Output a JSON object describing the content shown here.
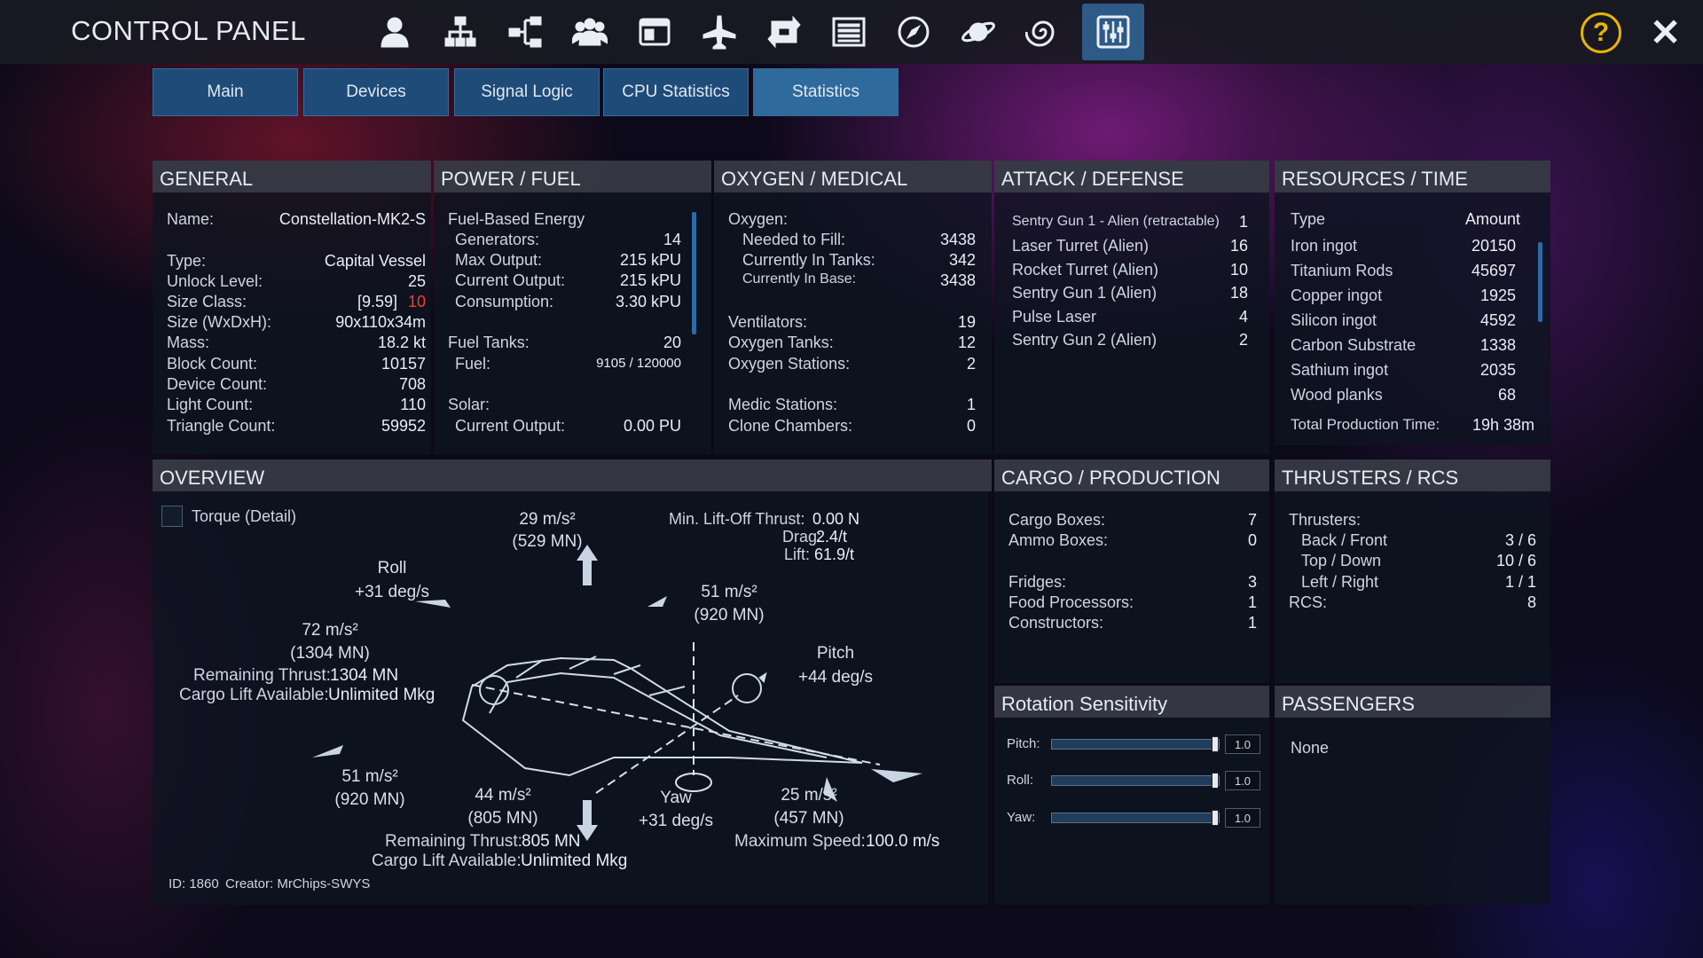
{
  "header": {
    "title": "CONTROL PANEL",
    "help_label": "?",
    "close_label": "✕"
  },
  "nav_icons": [
    "player-icon",
    "network-icon",
    "structure-icon",
    "group-icon",
    "window-icon",
    "aircraft-icon",
    "transfer-icon",
    "list-icon",
    "compass-icon",
    "planet-icon",
    "spiral-icon",
    "control-panel-icon"
  ],
  "tabs": [
    {
      "label": "Main"
    },
    {
      "label": "Devices"
    },
    {
      "label": "Signal Logic"
    },
    {
      "label": "CPU Statistics"
    },
    {
      "label": "Statistics"
    }
  ],
  "general": {
    "title": "GENERAL",
    "name_label": "Name:",
    "name": "Constellation-MK2-S",
    "type_label": "Type:",
    "type": "Capital Vessel",
    "unlock_label": "Unlock Level:",
    "unlock": "25",
    "sizeclass_label": "Size Class:",
    "sizeclass": "[9.59]",
    "sizeclass_max": "10",
    "size_label": "Size (WxDxH):",
    "size": "90x110x34m",
    "mass_label": "Mass:",
    "mass": "18.2 kt",
    "block_label": "Block Count:",
    "block": "10157",
    "device_label": "Device Count:",
    "device": "708",
    "light_label": "Light Count:",
    "light": "110",
    "tri_label": "Triangle Count:",
    "tri": "59952"
  },
  "power": {
    "title": "POWER / FUEL",
    "feb_label": "Fuel-Based Energy",
    "gen_label": "Generators:",
    "gen": "14",
    "maxout_label": "Max Output:",
    "maxout": "215 kPU",
    "curout_label": "Current Output:",
    "curout": "215 kPU",
    "cons_label": "Consumption:",
    "cons": "3.30 kPU",
    "tanks_label": "Fuel Tanks:",
    "tanks": "20",
    "fuel_label": "Fuel:",
    "fuel": "9105 / 120000",
    "solar_label": "Solar:",
    "solarout_label": "Current Output:",
    "solarout": "0.00 PU"
  },
  "oxygen": {
    "title": "OXYGEN / MEDICAL",
    "oxy_label": "Oxygen:",
    "fill_label": "Needed to Fill:",
    "fill": "3438",
    "tanks_label": "Currently In Tanks:",
    "tanks": "342",
    "base_label": "Currently In Base:",
    "base": "3438",
    "vent_label": "Ventilators:",
    "vent": "19",
    "otanks_label": "Oxygen Tanks:",
    "otanks": "12",
    "ostat_label": "Oxygen Stations:",
    "ostat": "2",
    "medic_label": "Medic Stations:",
    "medic": "1",
    "clone_label": "Clone Chambers:",
    "clone": "0"
  },
  "attack": {
    "title": "ATTACK / DEFENSE",
    "items": [
      {
        "name": "Sentry Gun 1 - Alien (retractable)",
        "count": "1"
      },
      {
        "name": "Laser Turret (Alien)",
        "count": "16"
      },
      {
        "name": "Rocket Turret (Alien)",
        "count": "10"
      },
      {
        "name": "Sentry Gun 1 (Alien)",
        "count": "18"
      },
      {
        "name": "Pulse Laser",
        "count": "4"
      },
      {
        "name": "Sentry Gun 2 (Alien)",
        "count": "2"
      }
    ]
  },
  "resources": {
    "title": "RESOURCES / TIME",
    "col_type": "Type",
    "col_amount": "Amount",
    "items": [
      {
        "name": "Iron ingot",
        "amount": "20150"
      },
      {
        "name": "Titanium Rods",
        "amount": "45697"
      },
      {
        "name": "Copper ingot",
        "amount": "1925"
      },
      {
        "name": "Silicon ingot",
        "amount": "4592"
      },
      {
        "name": "Carbon Substrate",
        "amount": "1338"
      },
      {
        "name": "Sathium ingot",
        "amount": "2035"
      },
      {
        "name": "Wood planks",
        "amount": "68"
      }
    ],
    "time_label": "Total Production Time:",
    "time": "19h 38m"
  },
  "overview": {
    "title": "OVERVIEW",
    "torque_label": "Torque (Detail)",
    "up_accel": "29 m/s²",
    "up_force": "(529 MN)",
    "liftoff_label": "Min. Lift-Off Thrust:",
    "liftoff": "0.00 N",
    "drag_label": "Drag:",
    "drag": "2.4/t",
    "lift_label": "Lift:",
    "lift": "61.9/t",
    "roll_label": "Roll",
    "roll": "+31 deg/s",
    "left_accel": "72 m/s²",
    "left_force": "(1304 MN)",
    "rem1_label": "Remaining Thrust:",
    "rem1": "1304 MN",
    "cargo1_label": "Cargo Lift Available:",
    "cargo1": "Unlimited Mkg",
    "fwd_accel": "51 m/s²",
    "fwd_force": "(920 MN)",
    "pitch_label": "Pitch",
    "pitch": "+44 deg/s",
    "bl_accel": "51 m/s²",
    "bl_force": "(920 MN)",
    "down_accel": "44 m/s²",
    "down_force": "(805 MN)",
    "yaw_label": "Yaw",
    "yaw": "+31 deg/s",
    "br_accel": "25 m/s²",
    "br_force": "(457 MN)",
    "rem2_label": "Remaining Thrust:",
    "rem2": "805 MN",
    "cargo2_label": "Cargo Lift Available:",
    "cargo2": "Unlimited Mkg",
    "maxspeed_label": "Maximum Speed:",
    "maxspeed": "100.0 m/s",
    "id_label": "ID: 1860",
    "creator_label": "Creator: MrChips-SWYS"
  },
  "cargo": {
    "title": "CARGO / PRODUCTION",
    "boxes_label": "Cargo Boxes:",
    "boxes": "7",
    "ammo_label": "Ammo Boxes:",
    "ammo": "0",
    "fridge_label": "Fridges:",
    "fridge": "3",
    "food_label": "Food Processors:",
    "food": "1",
    "constr_label": "Constructors:",
    "constr": "1"
  },
  "thrusters": {
    "title": "THRUSTERS / RCS",
    "thr_label": "Thrusters:",
    "bf_label": "Back / Front",
    "bf": "3 / 6",
    "td_label": "Top / Down",
    "td": "10 / 6",
    "lr_label": "Left / Right",
    "lr": "1 / 1",
    "rcs_label": "RCS:",
    "rcs": "8"
  },
  "rotation": {
    "title": "Rotation Sensitivity",
    "pitch_label": "Pitch:",
    "pitch": "1.0",
    "pitch_level": 1.0,
    "roll_label": "Roll:",
    "roll": "1.0",
    "roll_level": 1.0,
    "yaw_label": "Yaw:",
    "yaw": "1.0",
    "yaw_level": 1.0
  },
  "passengers": {
    "title": "PASSENGERS",
    "value": "None"
  }
}
